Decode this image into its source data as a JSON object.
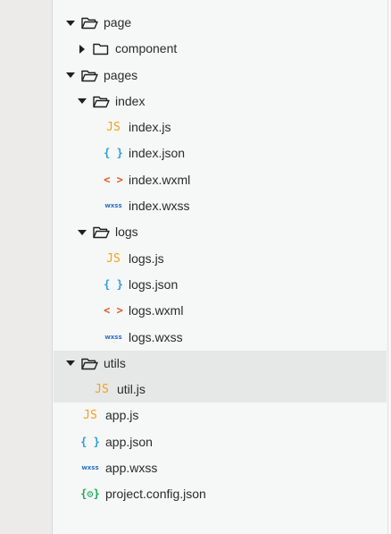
{
  "tree": [
    {
      "label": "page",
      "type": "folder",
      "expanded": true,
      "depth": 0
    },
    {
      "label": "component",
      "type": "folder",
      "expanded": false,
      "depth": 1
    },
    {
      "label": "pages",
      "type": "folder",
      "expanded": true,
      "depth": 0
    },
    {
      "label": "index",
      "type": "folder",
      "expanded": true,
      "depth": 1
    },
    {
      "label": "index.js",
      "type": "js",
      "depth": 2
    },
    {
      "label": "index.json",
      "type": "json",
      "depth": 2
    },
    {
      "label": "index.wxml",
      "type": "wxml",
      "depth": 2
    },
    {
      "label": "index.wxss",
      "type": "wxss",
      "depth": 2
    },
    {
      "label": "logs",
      "type": "folder",
      "expanded": true,
      "depth": 1
    },
    {
      "label": "logs.js",
      "type": "js",
      "depth": 2
    },
    {
      "label": "logs.json",
      "type": "json",
      "depth": 2
    },
    {
      "label": "logs.wxml",
      "type": "wxml",
      "depth": 2
    },
    {
      "label": "logs.wxss",
      "type": "wxss",
      "depth": 2
    },
    {
      "label": "utils",
      "type": "folder",
      "expanded": true,
      "depth": 0,
      "selected": true
    },
    {
      "label": "util.js",
      "type": "js",
      "depth": 1,
      "selected": true
    },
    {
      "label": "app.js",
      "type": "js",
      "depth": 0
    },
    {
      "label": "app.json",
      "type": "json",
      "depth": 0
    },
    {
      "label": "app.wxss",
      "type": "wxss",
      "depth": 0
    },
    {
      "label": "project.config.json",
      "type": "config",
      "depth": 0
    }
  ],
  "icon_glyphs": {
    "js": "JS",
    "json": "{ }",
    "wxml": "< >",
    "wxss": "wxss",
    "config": "{⚙}"
  }
}
